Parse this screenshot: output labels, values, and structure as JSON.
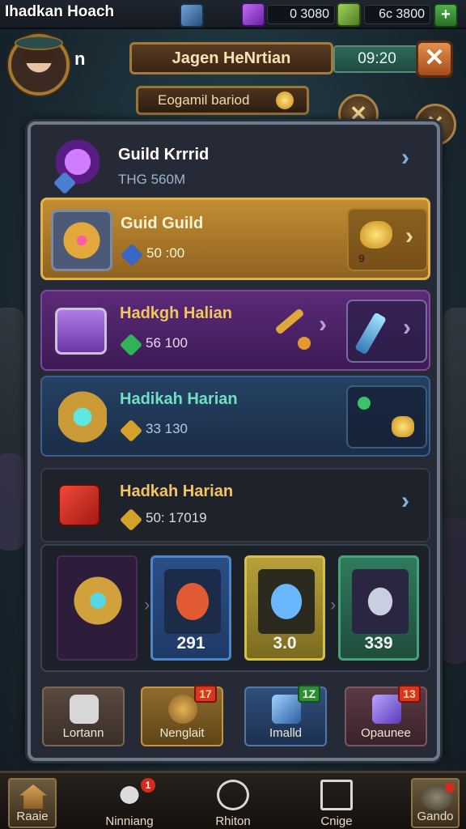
{
  "status_bar": {
    "game_title": "Ihadkan Hoach",
    "currency_a": "0  3080",
    "currency_b": "6c 3800",
    "add_symbol": "+"
  },
  "header": {
    "avatar_tag": "n",
    "player_name": "Jagen HeNrtian",
    "timer": "09:20",
    "close_symbol": "✕",
    "sub_banner": "Eogamil bariod"
  },
  "panel": {
    "rows": [
      {
        "title": "Guild Krrrid",
        "subtitle": "THG 560M"
      },
      {
        "title": "Guid Guild",
        "subtitle": "50 :00",
        "extra": "9"
      },
      {
        "title": "Hadkgh Halian",
        "subtitle": "56 100"
      },
      {
        "title": "Hadikah Harian",
        "subtitle": "33 130"
      },
      {
        "title": "Hadkah Harian",
        "subtitle": "50: 17019"
      }
    ],
    "rewards": [
      {
        "value": ""
      },
      {
        "value": "291"
      },
      {
        "value": "3.0"
      },
      {
        "value": "339"
      }
    ],
    "actions": [
      {
        "label": "Lortann",
        "badge": ""
      },
      {
        "label": "Nenglait",
        "badge": "17"
      },
      {
        "label": "Imalld",
        "badge": "1Z"
      },
      {
        "label": "Opaunee",
        "badge": "13"
      }
    ]
  },
  "nav": [
    {
      "label": "Raaie",
      "badge": ""
    },
    {
      "label": "Ninniang",
      "badge": "1"
    },
    {
      "label": "Rhiton",
      "badge": ""
    },
    {
      "label": "Cnige",
      "badge": ""
    },
    {
      "label": "Gando",
      "badge": ""
    }
  ],
  "colors": {
    "gold": "#c28d32",
    "purple": "#5b2a78",
    "blue": "#254163",
    "accent_red": "#d32c1c"
  }
}
